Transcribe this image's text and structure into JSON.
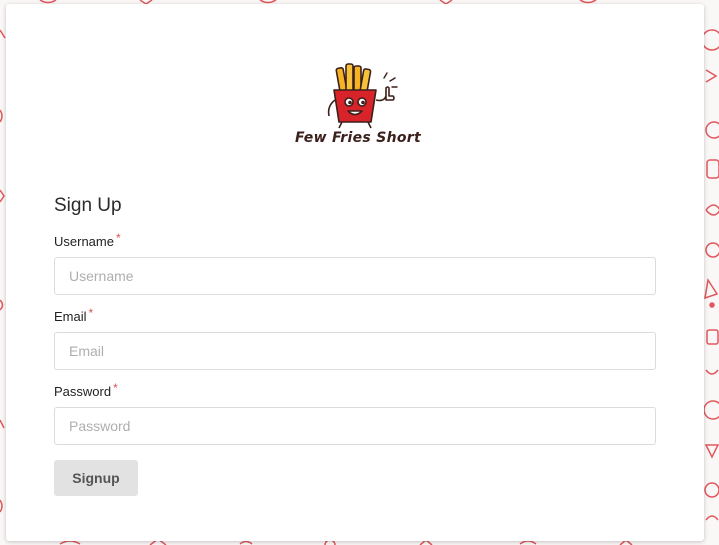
{
  "brand": {
    "name": "Few Fries Short",
    "logo_icon": "fries-mascot-icon",
    "accent_color": "#d8232a"
  },
  "background": {
    "pattern_icon": "food-doodle-pattern",
    "pattern_color": "#d8232a"
  },
  "form": {
    "title": "Sign Up",
    "required_marker": "*",
    "fields": [
      {
        "label": "Username",
        "placeholder": "Username",
        "value": ""
      },
      {
        "label": "Email",
        "placeholder": "Email",
        "value": ""
      },
      {
        "label": "Password",
        "placeholder": "Password",
        "value": ""
      }
    ],
    "submit_label": "Signup"
  }
}
